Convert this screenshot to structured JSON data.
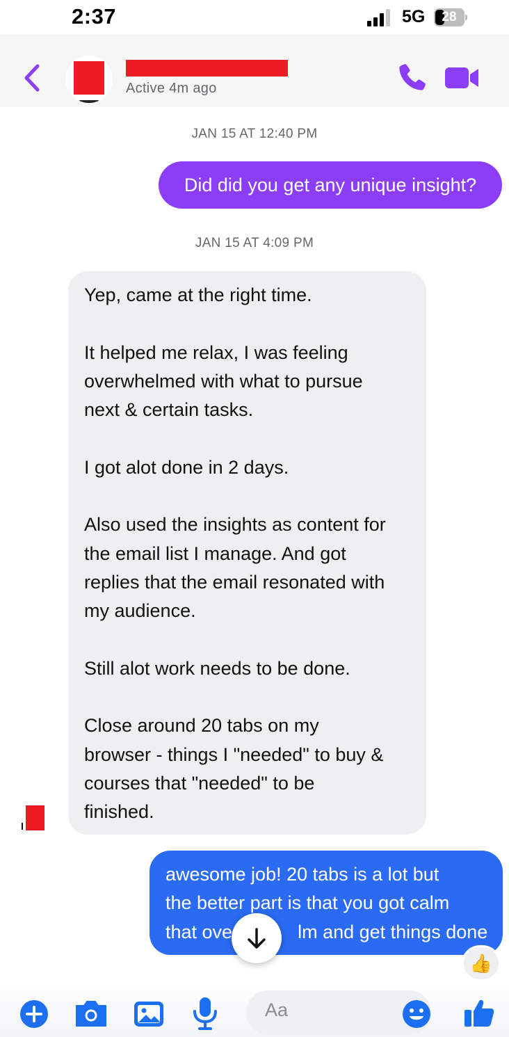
{
  "status_bar": {
    "time": "2:37",
    "network": "5G",
    "battery": "28"
  },
  "header": {
    "contact_status": "Active 4m ago"
  },
  "conversation": {
    "timestamp_1": "JAN 15 AT 12:40 PM",
    "outgoing_message_1": "Did did you get any unique insight?",
    "timestamp_2": "JAN 15 AT 4:09 PM",
    "incoming_message": [
      "Yep, came at the right time.",
      "",
      "It helped me relax, I was feeling",
      "overwhelmed with what to pursue",
      "next & certain tasks.",
      "",
      "I got alot done in 2 days.",
      "",
      "Also used the insights as content for",
      "the email list I manage. And got",
      "replies that the email resonated with",
      "my audience.",
      "",
      "Still alot work needs to be done.",
      "",
      "Close around 20 tabs on my",
      "browser - things I \"needed\" to buy &",
      "courses that \"needed\" to be",
      "finished."
    ],
    "outgoing_message_2": [
      "awesome job! 20 tabs is a lot but",
      "the better part is that you got calm",
      "that ove",
      "lm and get things done"
    ],
    "reaction": "👍"
  },
  "composer": {
    "placeholder": "Aa"
  },
  "colors": {
    "accent_purple": "#8b3ef6",
    "outgoing_blue": "#2b6bf3",
    "composer_blue": "#1d6ff2",
    "incoming_gray": "#efeff1",
    "redaction_red": "#ed1c24"
  },
  "icons": [
    "back-chevron-icon",
    "phone-icon",
    "video-camera-icon",
    "plus-icon",
    "camera-icon",
    "gallery-icon",
    "microphone-icon",
    "emoji-icon",
    "thumbs-up-icon",
    "arrow-down-icon"
  ]
}
